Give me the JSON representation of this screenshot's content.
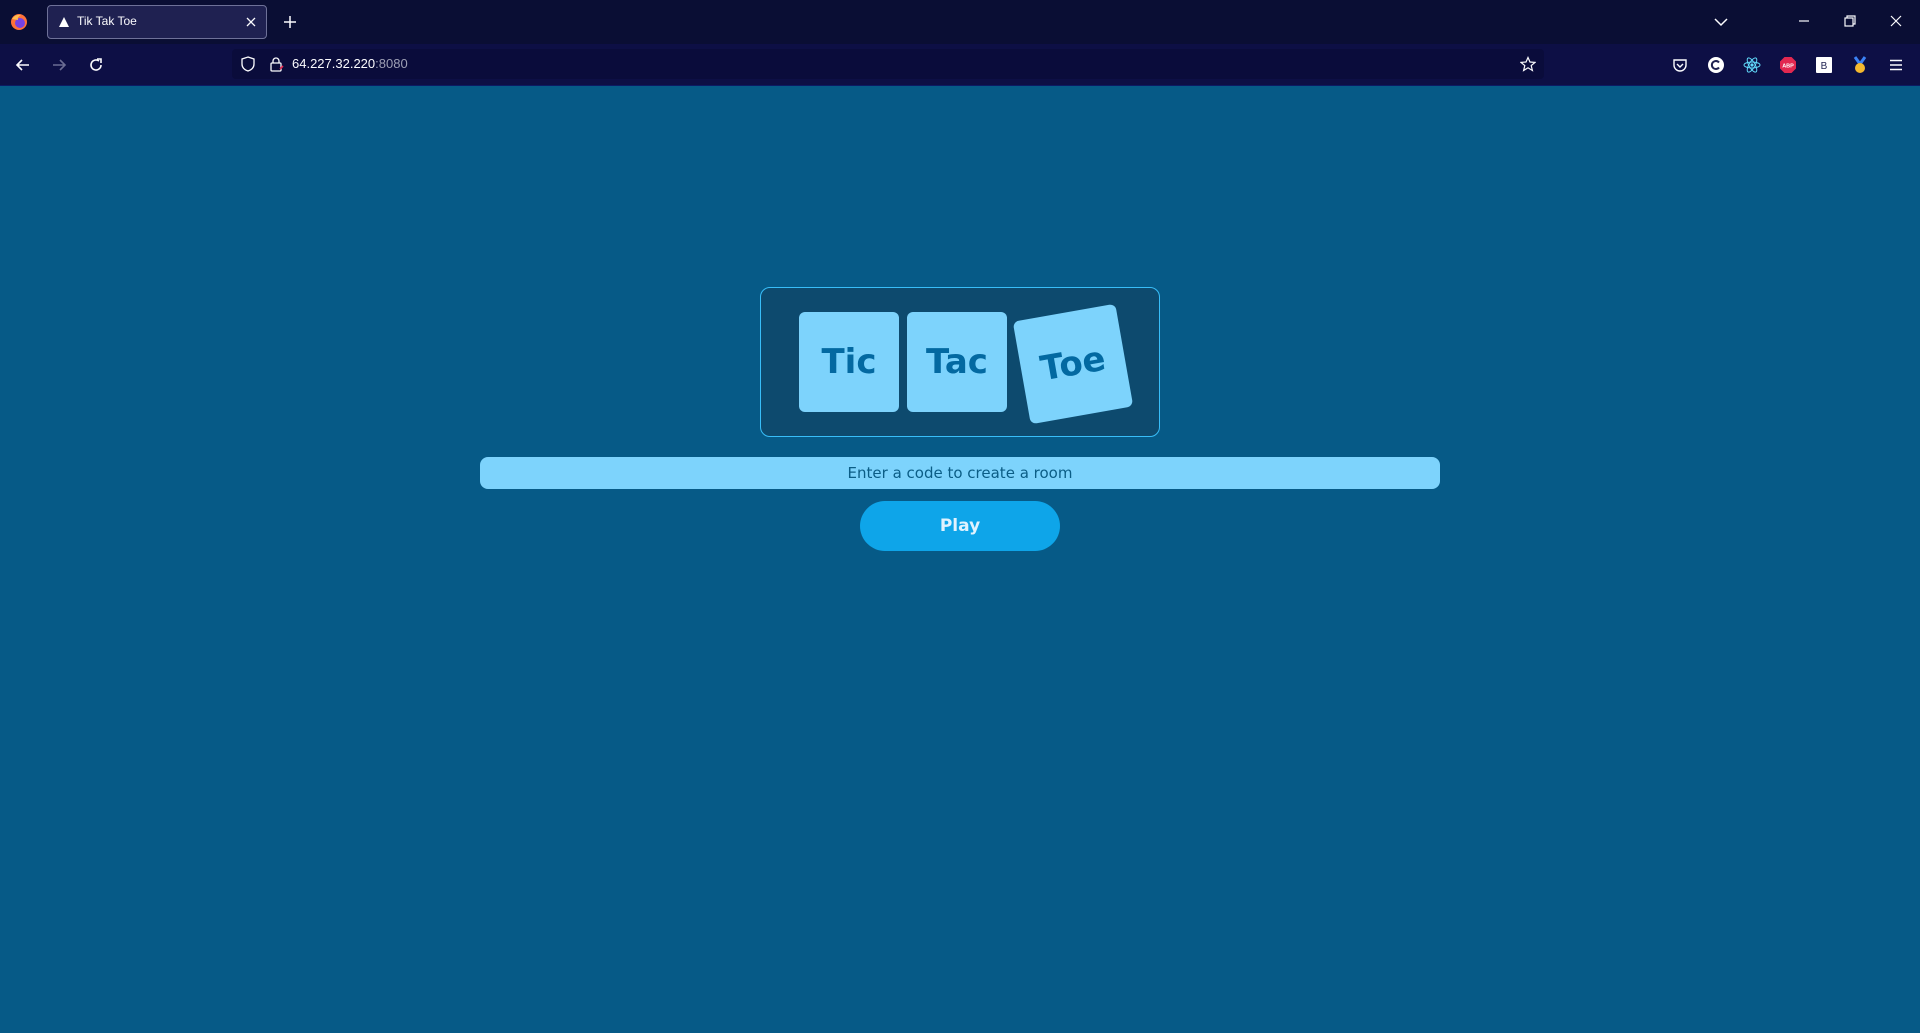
{
  "browser": {
    "tab": {
      "title": "Tik Tak Toe"
    },
    "url": {
      "host": "64.227.32.220",
      "port": ":8080"
    },
    "icons": [
      "firefox-logo",
      "close-icon",
      "plus-icon",
      "chevron-down-icon",
      "minimize-icon",
      "restore-icon",
      "close-window-icon",
      "back-arrow-icon",
      "forward-arrow-icon",
      "reload-icon",
      "shield-icon",
      "lock-icon",
      "star-icon",
      "pocket-icon",
      "extension-c-icon",
      "react-devtools-icon",
      "adblock-icon",
      "extension-b-icon",
      "badge-icon",
      "hamburger-menu-icon"
    ]
  },
  "game": {
    "logo_tiles": [
      "Tic",
      "Tac",
      "Toe"
    ],
    "room_input": {
      "placeholder": "Enter a code to create a room",
      "value": ""
    },
    "play_button": "Play"
  },
  "colors": {
    "background": "#065a87",
    "tile": "#7dd3fc",
    "tile_text": "#0369a1",
    "button": "#0ea5e9",
    "card_border": "#38bdf8"
  }
}
